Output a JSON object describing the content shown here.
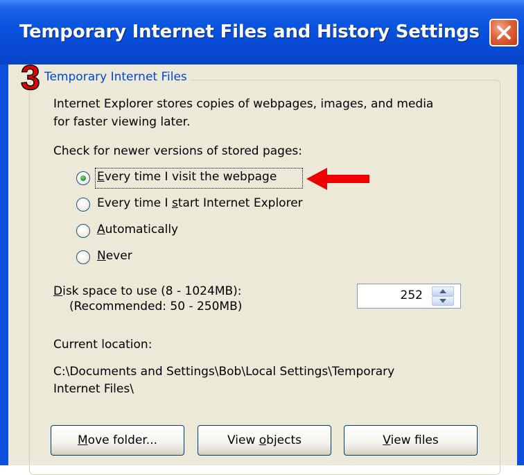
{
  "window": {
    "title": "Temporary Internet Files and History Settings"
  },
  "annotation": {
    "step_number": "3"
  },
  "group": {
    "legend": "Temporary Internet Files",
    "description_line1": "Internet Explorer stores copies of webpages, images, and media",
    "description_line2": "for faster viewing later.",
    "check_label": "Check for newer versions of stored pages:"
  },
  "radios": [
    {
      "label": "Every time I visit the webpage",
      "checked": true
    },
    {
      "label": "Every time I start Internet Explorer",
      "checked": false
    },
    {
      "label": "Automatically",
      "checked": false
    },
    {
      "label": "Never",
      "checked": false
    }
  ],
  "disk": {
    "label": "Disk space to use (8 - 1024MB):",
    "recommended": "(Recommended: 50 - 250MB)",
    "value": "252"
  },
  "location": {
    "label": "Current location:",
    "path_line1": "C:\\Documents and Settings\\Bob\\Local Settings\\Temporary",
    "path_line2": "Internet Files\\"
  },
  "buttons": {
    "move_folder": "Move folder...",
    "view_objects": "View objects",
    "view_files": "View files"
  },
  "colors": {
    "title_blue": "#0a55e0",
    "dialog_bg": "#ece9d8",
    "legend_blue": "#0046d5",
    "annotation_red": "#e00000"
  }
}
